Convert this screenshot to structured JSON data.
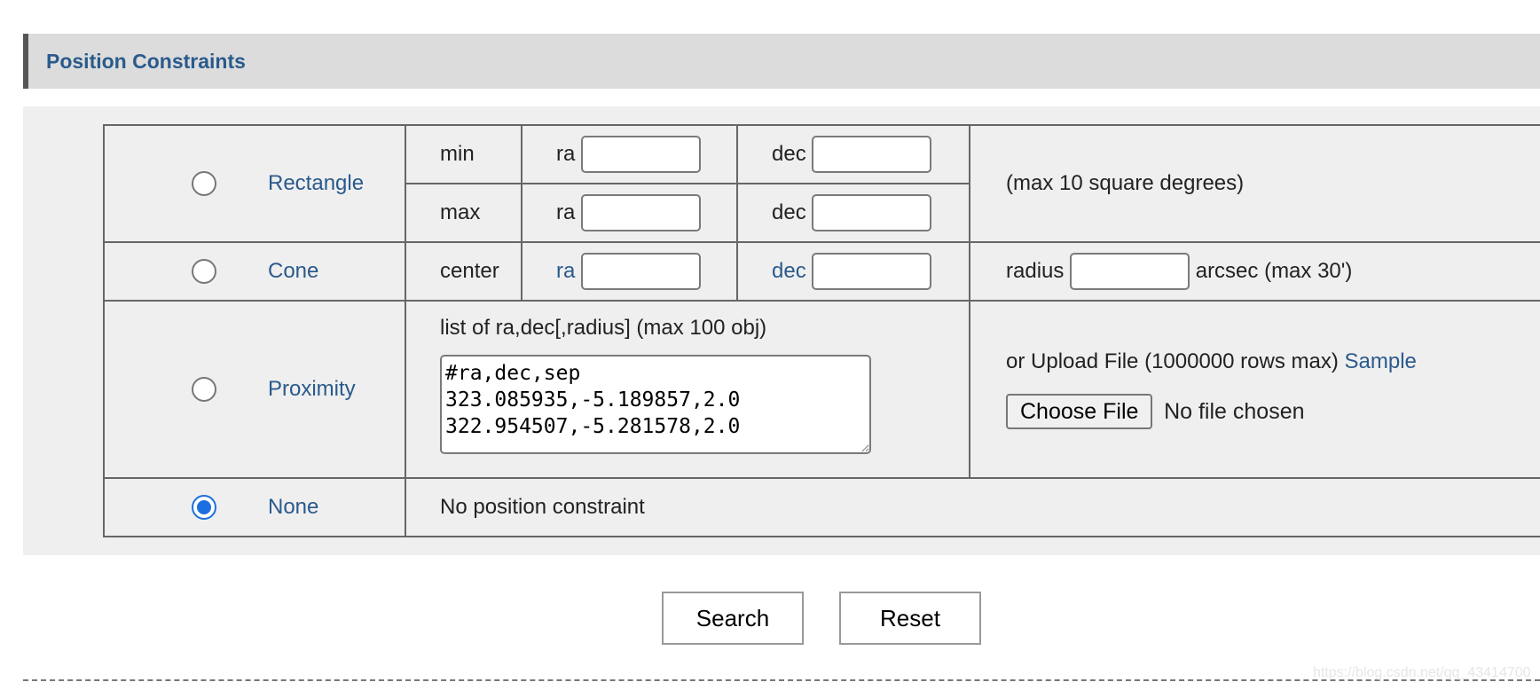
{
  "section": {
    "title": "Position Constraints"
  },
  "rectangle": {
    "label": "Rectangle",
    "min_label": "min",
    "max_label": "max",
    "ra_label": "ra",
    "dec_label": "dec",
    "note": "(max 10 square degrees)"
  },
  "cone": {
    "label": "Cone",
    "center_label": "center",
    "ra_label": "ra",
    "dec_label": "dec",
    "radius_label": "radius",
    "radius_unit": "arcsec (max 30')"
  },
  "proximity": {
    "label": "Proximity",
    "list_label": "list of ra,dec[,radius] (max 100 obj)",
    "list_value": "#ra,dec,sep\n323.085935,-5.189857,2.0\n322.954507,-5.281578,2.0",
    "upload_label": "or Upload File (1000000 rows max)",
    "sample_link": "Sample",
    "choose_file": "Choose File",
    "no_file": "No file chosen"
  },
  "none": {
    "label": "None",
    "text": "No position constraint"
  },
  "selected": "none",
  "buttons": {
    "search": "Search",
    "reset": "Reset"
  },
  "watermark": "https://blog.csdn.net/qq_43414700"
}
